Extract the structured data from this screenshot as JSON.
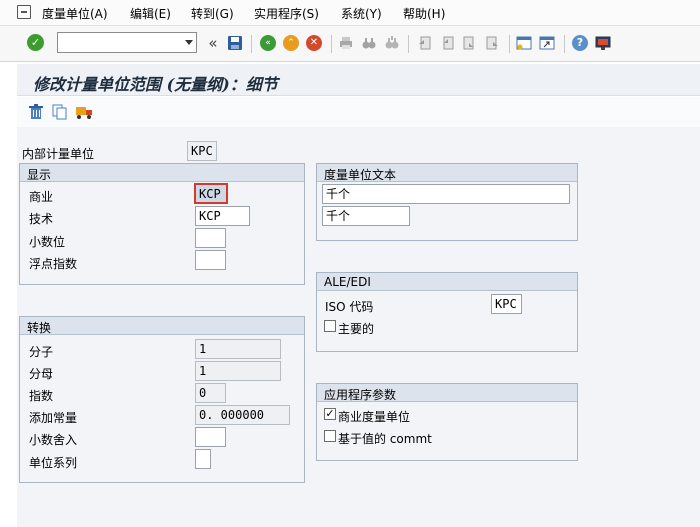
{
  "menu": {
    "items": [
      {
        "label": "度量单位(A)"
      },
      {
        "label": "编辑(E)"
      },
      {
        "label": "转到(G)"
      },
      {
        "label": "实用程序(S)"
      },
      {
        "label": "系统(Y)"
      },
      {
        "label": "帮助(H)"
      }
    ]
  },
  "toolbar": {
    "command_value": "",
    "back_chevron": "«"
  },
  "page": {
    "title": "修改计量单位范围 (无量纲)：细节"
  },
  "header": {
    "internal_uom_label": "内部计量单位",
    "internal_uom_value": "KPC"
  },
  "display_group": {
    "title": "显示",
    "commercial_label": "商业",
    "commercial_value": "KCP",
    "technical_label": "技术",
    "technical_value": "KCP",
    "decimals_label": "小数位",
    "decimals_value": "",
    "exponent_label": "浮点指数",
    "exponent_value": ""
  },
  "text_group": {
    "title": "度量单位文本",
    "long_text": "千个",
    "short_text": "千个"
  },
  "ale_group": {
    "title": "ALE/EDI",
    "iso_label": "ISO 代码",
    "iso_value": "KPC",
    "primary_label": "主要的",
    "primary_checked": false
  },
  "conversion_group": {
    "title": "转换",
    "numerator_label": "分子",
    "numerator_value": "1",
    "denominator_label": "分母",
    "denominator_value": "1",
    "exponent_label": "指数",
    "exponent_value": "0",
    "additive_label": "添加常量",
    "additive_value": "0. 000000",
    "rounding_label": "小数舍入",
    "rounding_value": "",
    "unit_system_label": "单位系列",
    "unit_system_value": ""
  },
  "app_params_group": {
    "title": "应用程序参数",
    "commercial_uom_label": "商业度量单位",
    "commercial_uom_checked": true,
    "value_based_label": "基于值的 commt",
    "value_based_checked": false
  }
}
